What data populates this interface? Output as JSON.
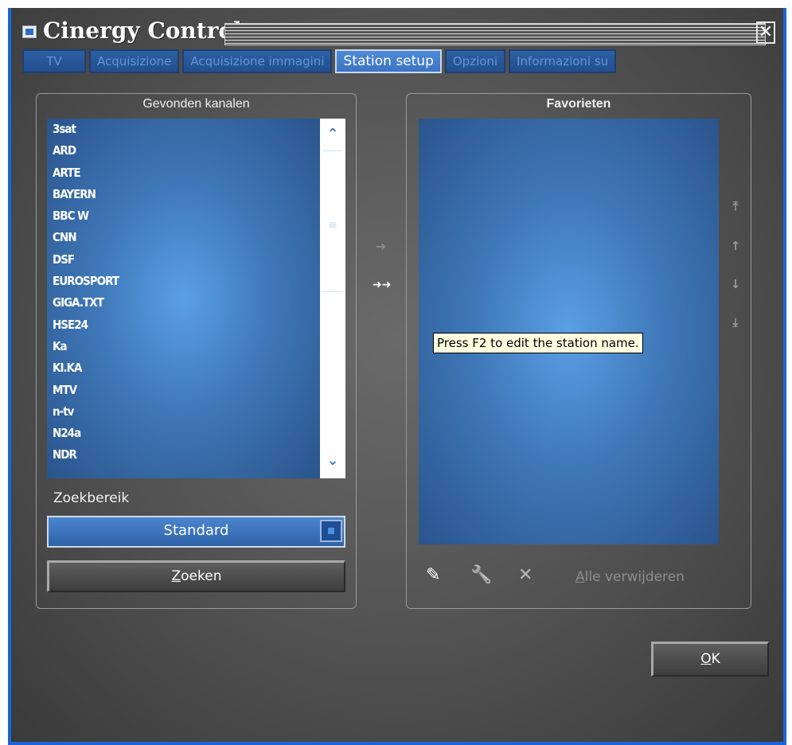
{
  "window": {
    "title": "Cinergy Control",
    "close_glyph": "✕"
  },
  "tabs": [
    {
      "label": "TV",
      "active": false
    },
    {
      "label": "Acquisizione",
      "active": false
    },
    {
      "label": "Acquisizione immagini",
      "active": false
    },
    {
      "label": "Station setup",
      "active": true
    },
    {
      "label": "Opzioni",
      "active": false
    },
    {
      "label": "Informazioni su",
      "active": false
    }
  ],
  "found_channels": {
    "title": "Gevonden kanalen",
    "items": [
      "3sat",
      "ARD",
      "ARTE",
      "BAYERN",
      "BBC W",
      "CNN",
      "DSF",
      "EUROSPORT",
      "GIGA.TXT",
      "HSE24",
      "Ka",
      "KI.KA",
      "MTV",
      "n-tv",
      "N24a",
      "NDR"
    ],
    "scroll_up": "⌃",
    "scroll_down": "⌄",
    "scroll_grip": "≡",
    "search_range_label": "Zoekbereik",
    "search_range_value": "Standard",
    "search_button_prefix": "Z",
    "search_button_rest": "oeken"
  },
  "transfer": {
    "add_one": "➜",
    "add_all": "➜➜"
  },
  "favorites": {
    "title": "Favorieten",
    "tooltip": "Press F2 to edit the station name.",
    "move_top": "⤒",
    "move_up": "↑",
    "move_down": "↓",
    "move_bottom": "⤓",
    "rename_icon": "✎",
    "settings_icon": "🔧",
    "delete_icon": "✕",
    "remove_all_prefix": "A",
    "remove_all_rest": "lle verwijderen"
  },
  "ok_button": {
    "prefix": "O",
    "rest": "K"
  }
}
